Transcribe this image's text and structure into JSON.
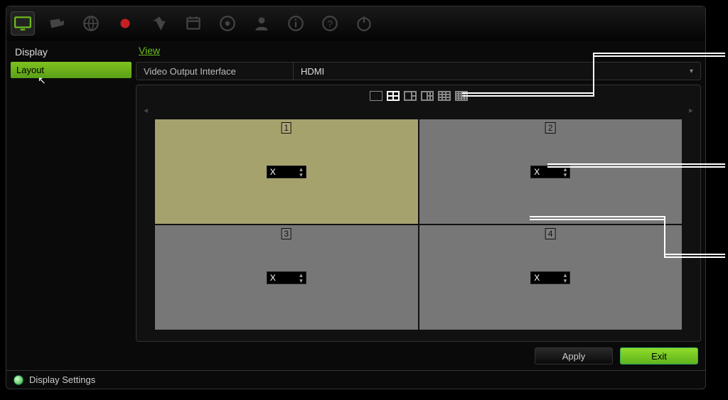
{
  "toolbar": {
    "icons": [
      {
        "name": "monitor-icon",
        "active": true
      },
      {
        "name": "camera-icon",
        "active": false
      },
      {
        "name": "globe-icon",
        "active": false
      },
      {
        "name": "record-icon",
        "active": false
      },
      {
        "name": "alarm-icon",
        "active": false
      },
      {
        "name": "schedule-icon",
        "active": false
      },
      {
        "name": "disk-icon",
        "active": false
      },
      {
        "name": "user-icon",
        "active": false
      },
      {
        "name": "info-icon",
        "active": false
      },
      {
        "name": "help-icon",
        "active": false
      },
      {
        "name": "power-icon",
        "active": false
      }
    ]
  },
  "sidebar": {
    "title": "Display",
    "items": [
      {
        "label": "Layout",
        "active": true
      }
    ]
  },
  "tabs": [
    {
      "label": "View",
      "active": true
    }
  ],
  "form": {
    "output_interface_label": "Video Output Interface",
    "output_interface_value": "HDMI"
  },
  "layout_options": [
    {
      "name": "layout-1x1"
    },
    {
      "name": "layout-2x2"
    },
    {
      "name": "layout-1p3"
    },
    {
      "name": "layout-1p5"
    },
    {
      "name": "layout-3x3"
    },
    {
      "name": "layout-4x4"
    }
  ],
  "cells": [
    {
      "num": "1",
      "value": "X",
      "selected": true
    },
    {
      "num": "2",
      "value": "X",
      "selected": false
    },
    {
      "num": "3",
      "value": "X",
      "selected": false
    },
    {
      "num": "4",
      "value": "X",
      "selected": false
    }
  ],
  "buttons": {
    "apply": "Apply",
    "exit": "Exit"
  },
  "status": {
    "text": "Display Settings"
  }
}
